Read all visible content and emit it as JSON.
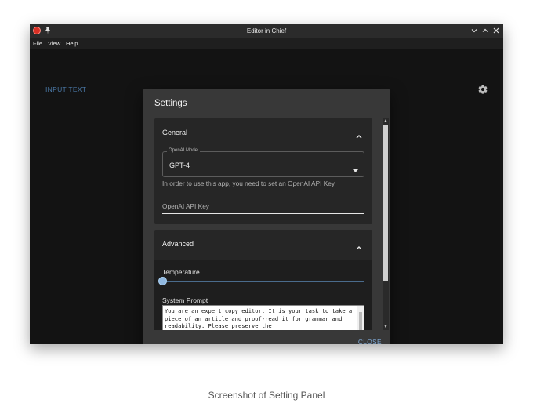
{
  "window": {
    "title": "Editor in Chief",
    "menu": [
      "File",
      "View",
      "Help"
    ]
  },
  "main": {
    "input_label": "INPUT TEXT"
  },
  "settings_dialog": {
    "title": "Settings",
    "general": {
      "header": "General",
      "model_label": "OpenAI Model",
      "model_value": "GPT-4",
      "helper_text": "In order to use this app, you need to set an OpenAI API Key.",
      "api_key_placeholder": "OpenAI API Key"
    },
    "advanced": {
      "header": "Advanced",
      "temperature_label": "Temperature",
      "temperature_value": 0,
      "system_prompt_label": "System Prompt",
      "system_prompt_text": "You are an expert copy editor. It is your task to take a piece of an article and proof-read it for grammar and readability. Please preserve the"
    },
    "close_label": "CLOSE"
  },
  "caption": "Screenshot of Setting Panel",
  "colors": {
    "accent": "#7fa8d4",
    "background": "#131313",
    "dialog": "#383838"
  }
}
